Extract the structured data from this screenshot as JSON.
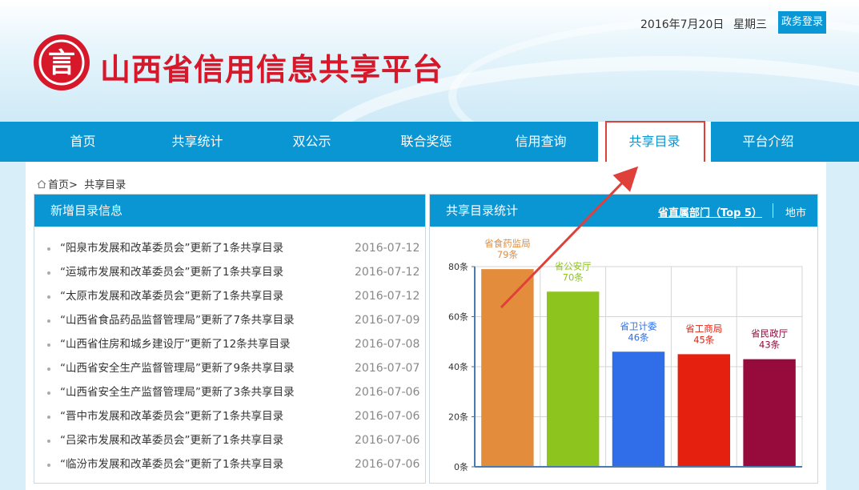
{
  "header": {
    "date": "2016年7月20日",
    "weekday": "星期三",
    "login_label": "政务登录",
    "logo_char": "言",
    "site_title": "山西省信用信息共享平台"
  },
  "nav": {
    "items": [
      {
        "label": "首页"
      },
      {
        "label": "共享统计"
      },
      {
        "label": "双公示"
      },
      {
        "label": "联合奖惩"
      },
      {
        "label": "信用查询"
      },
      {
        "label": "共享目录"
      },
      {
        "label": "平台介绍"
      }
    ],
    "active_index": 5
  },
  "breadcrumb": {
    "home": "首页",
    "separator": ">",
    "current": "共享目录"
  },
  "left_panel": {
    "title": "新增目录信息",
    "items": [
      {
        "title": "“阳泉市发展和改革委员会”更新了1条共享目录",
        "date": "2016-07-12"
      },
      {
        "title": "“运城市发展和改革委员会”更新了1条共享目录",
        "date": "2016-07-12"
      },
      {
        "title": "“太原市发展和改革委员会”更新了1条共享目录",
        "date": "2016-07-12"
      },
      {
        "title": "“山西省食品药品监督管理局”更新了7条共享目录",
        "date": "2016-07-09"
      },
      {
        "title": "“山西省住房和城乡建设厅”更新了12条共享目录",
        "date": "2016-07-08"
      },
      {
        "title": "“山西省安全生产监督管理局”更新了9条共享目录",
        "date": "2016-07-07"
      },
      {
        "title": "“山西省安全生产监督管理局”更新了3条共享目录",
        "date": "2016-07-06"
      },
      {
        "title": "“晋中市发展和改革委员会”更新了1条共享目录",
        "date": "2016-07-06"
      },
      {
        "title": "“吕梁市发展和改革委员会”更新了1条共享目录",
        "date": "2016-07-06"
      },
      {
        "title": "“临汾市发展和改革委员会”更新了1条共享目录",
        "date": "2016-07-06"
      }
    ]
  },
  "right_panel": {
    "title": "共享目录统计",
    "tab_active": "省直属部门（Top 5）",
    "tab_other": "地市"
  },
  "chart_data": {
    "type": "bar",
    "categories": [
      "省食药监局",
      "省公安厅",
      "省卫计委",
      "省工商局",
      "省民政厅"
    ],
    "values": [
      79,
      70,
      46,
      45,
      43
    ],
    "value_labels": [
      "79条",
      "70条",
      "46条",
      "45条",
      "43条"
    ],
    "colors": [
      "#e38c3c",
      "#8ec41e",
      "#2f6ee8",
      "#e6200e",
      "#960a3c"
    ],
    "ylim": [
      0,
      80
    ],
    "yticks": [
      0,
      20,
      40,
      60,
      80
    ],
    "ytick_labels": [
      "0条",
      "20条",
      "40条",
      "60条",
      "80条"
    ],
    "grid": true
  },
  "annotation": {
    "color": "#e0403a"
  }
}
